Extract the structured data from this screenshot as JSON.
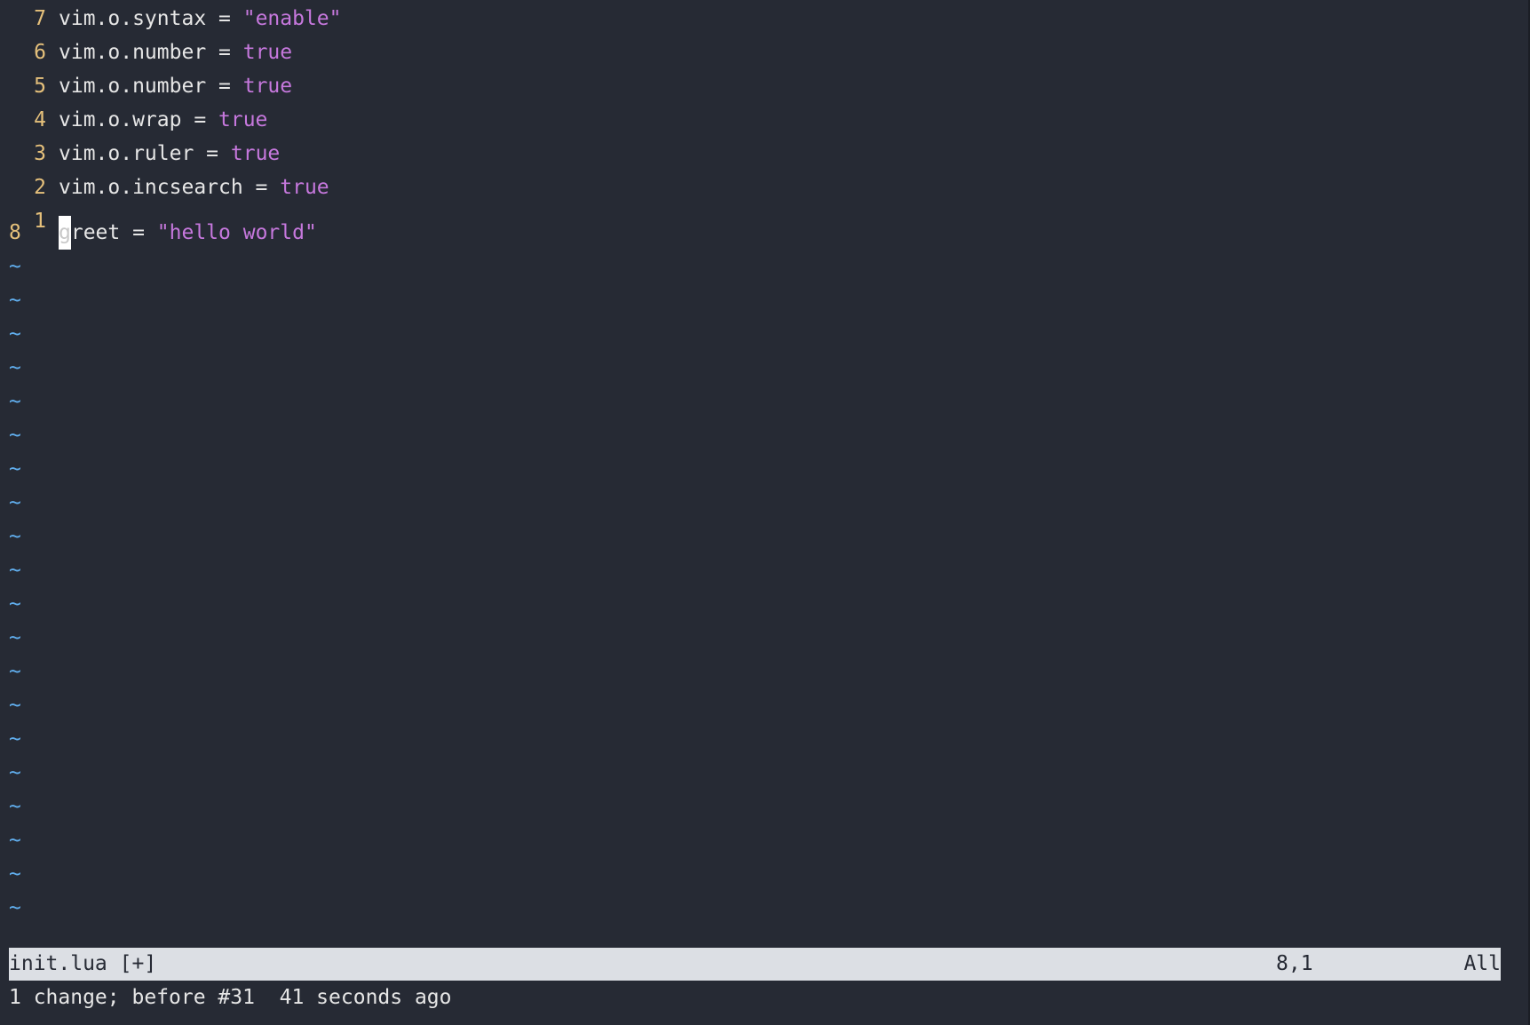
{
  "buffer": {
    "lines": [
      {
        "num": "7",
        "tokens": [
          {
            "t": "vim.o.syntax = ",
            "k": "ident"
          },
          {
            "t": "\"enable\"",
            "k": "lit"
          }
        ]
      },
      {
        "num": "6",
        "tokens": [
          {
            "t": "vim.o.number = ",
            "k": "ident"
          },
          {
            "t": "true",
            "k": "lit"
          }
        ]
      },
      {
        "num": "5",
        "tokens": [
          {
            "t": "vim.o.number = ",
            "k": "ident"
          },
          {
            "t": "true",
            "k": "lit"
          }
        ]
      },
      {
        "num": "4",
        "tokens": [
          {
            "t": "vim.o.wrap = ",
            "k": "ident"
          },
          {
            "t": "true",
            "k": "lit"
          }
        ]
      },
      {
        "num": "3",
        "tokens": [
          {
            "t": "vim.o.ruler = ",
            "k": "ident"
          },
          {
            "t": "true",
            "k": "lit"
          }
        ]
      },
      {
        "num": "2",
        "tokens": [
          {
            "t": "vim.o.incsearch = ",
            "k": "ident"
          },
          {
            "t": "true",
            "k": "lit"
          }
        ]
      },
      {
        "num": "1",
        "tokens": []
      }
    ],
    "current_line": {
      "num": "8",
      "cursor_char": "g",
      "rest_ident": "reet = ",
      "rest_lit": "\"hello world\""
    },
    "tilde_char": "~",
    "tilde_count": 20
  },
  "statusline": {
    "filename": "init.lua [+]",
    "position": "8,1",
    "percent": "All"
  },
  "cmdline": {
    "message": "1 change; before #31  41 seconds ago"
  },
  "colors": {
    "background": "#262a34",
    "line_number": "#e5c07b",
    "literal": "#c678dd",
    "tilde": "#61afef",
    "statusline_bg": "#dcdfe4"
  }
}
